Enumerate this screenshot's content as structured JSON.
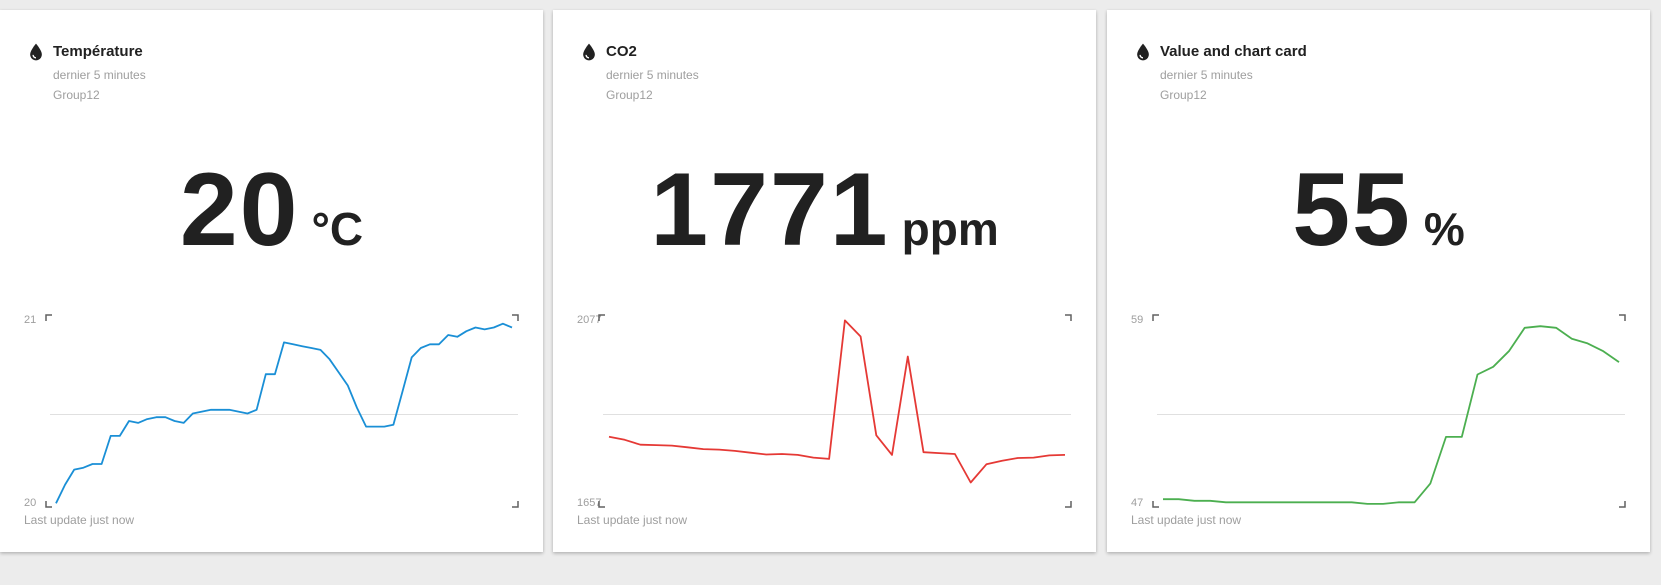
{
  "cards": [
    {
      "title": "Température",
      "subtitle": "dernier 5 minutes",
      "group": "Group12",
      "value": "20",
      "unit": "°C",
      "y_max_label": "21",
      "y_min_label": "20",
      "footer": "Last update just now",
      "color": "#1a8fd6",
      "icon": "water-drop-icon",
      "chart_data": {
        "type": "line",
        "ylim": [
          20,
          21
        ],
        "values": [
          20.02,
          20.12,
          20.2,
          20.21,
          20.23,
          20.23,
          20.38,
          20.38,
          20.46,
          20.45,
          20.47,
          20.48,
          20.48,
          20.46,
          20.45,
          20.5,
          20.51,
          20.52,
          20.52,
          20.52,
          20.51,
          20.5,
          20.52,
          20.71,
          20.71,
          20.88,
          20.87,
          20.86,
          20.85,
          20.84,
          20.79,
          20.72,
          20.65,
          20.53,
          20.43,
          20.43,
          20.43,
          20.44,
          20.62,
          20.8,
          20.85,
          20.87,
          20.87,
          20.92,
          20.91,
          20.94,
          20.96,
          20.95,
          20.96,
          20.98,
          20.96
        ]
      }
    },
    {
      "title": "CO2",
      "subtitle": "dernier 5 minutes",
      "group": "Group12",
      "value": "1771",
      "unit": "ppm",
      "y_max_label": "2077",
      "y_min_label": "1657",
      "footer": "Last update just now",
      "color": "#e53935",
      "icon": "water-drop-icon",
      "chart_data": {
        "type": "line",
        "ylim": [
          1657,
          2077
        ],
        "values": [
          1815,
          1808,
          1797,
          1796,
          1795,
          1791,
          1787,
          1786,
          1783,
          1779,
          1775,
          1776,
          1774,
          1768,
          1765,
          2076,
          2040,
          1818,
          1774,
          1995,
          1780,
          1778,
          1776,
          1712,
          1753,
          1761,
          1767,
          1768,
          1773,
          1774
        ]
      }
    },
    {
      "title": "Value and chart card",
      "subtitle": "dernier 5 minutes",
      "group": "Group12",
      "value": "55",
      "unit": "%",
      "y_max_label": "59",
      "y_min_label": "47",
      "footer": "Last update just now",
      "color": "#4caf50",
      "icon": "water-drop-icon",
      "chart_data": {
        "type": "line",
        "ylim": [
          47,
          59
        ],
        "values": [
          47.5,
          47.5,
          47.4,
          47.4,
          47.3,
          47.3,
          47.3,
          47.3,
          47.3,
          47.3,
          47.3,
          47.3,
          47.3,
          47.2,
          47.2,
          47.3,
          47.3,
          48.5,
          51.5,
          51.5,
          55.5,
          56.0,
          57.0,
          58.5,
          58.6,
          58.5,
          57.8,
          57.5,
          57.0,
          56.3
        ]
      }
    }
  ]
}
